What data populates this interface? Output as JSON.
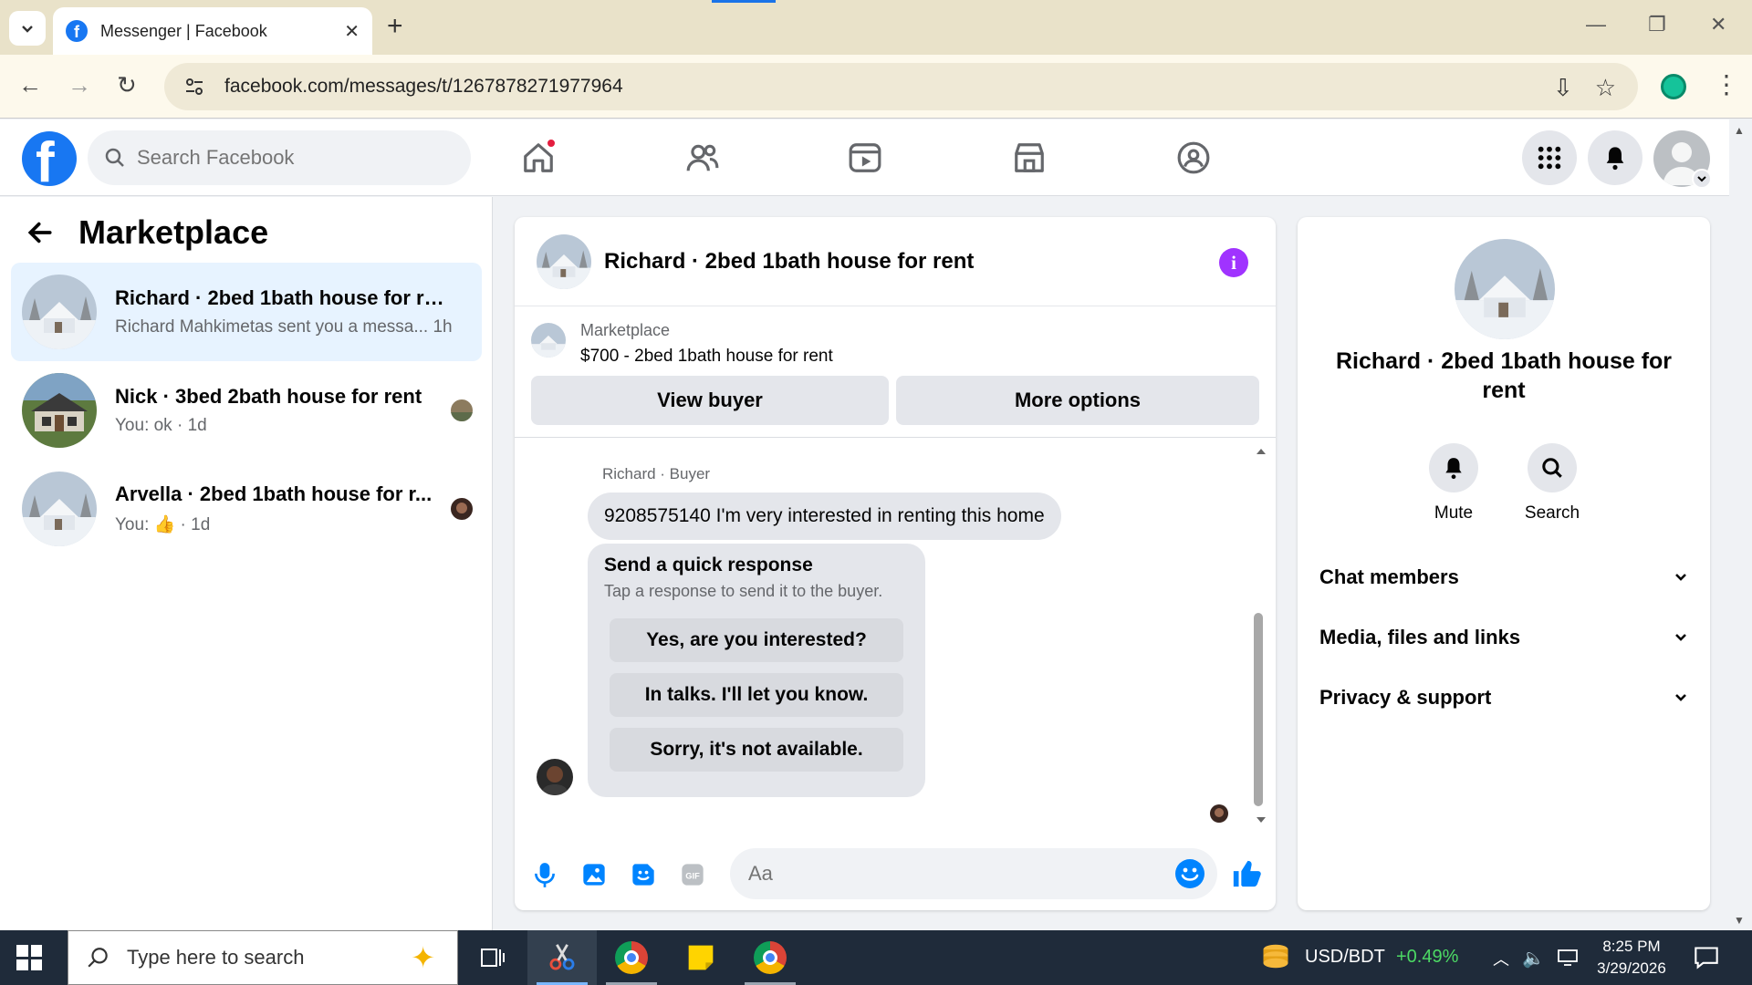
{
  "browser": {
    "tab_title": "Messenger | Facebook",
    "url": "facebook.com/messages/t/1267878271977964"
  },
  "fbnav": {
    "search_placeholder": "Search Facebook"
  },
  "left": {
    "title": "Marketplace",
    "conversations": [
      {
        "name": "Richard · 2bed 1bath house for rent",
        "subtitle": "Richard Mahkimetas sent you a messa... 1h"
      },
      {
        "name": "Nick · 3bed 2bath house for rent",
        "subtitle": "You: ok · 1d"
      },
      {
        "name": "Arvella · 2bed 1bath house for r...",
        "subtitle": "You: 👍 · 1d"
      }
    ]
  },
  "chat": {
    "title": "Richard · 2bed 1bath house for rent",
    "marketplace_label": "Marketplace",
    "listing": "$700 - 2bed 1bath house for rent",
    "view_buyer_label": "View buyer",
    "more_options_label": "More options",
    "sender_label": "Richard · Buyer",
    "message_text": "9208575140 I'm very interested in renting this home",
    "quick_title": "Send a quick response",
    "quick_subtitle": "Tap a response to send it to the buyer.",
    "quick_responses": [
      "Yes, are you interested?",
      "In talks. I'll let you know.",
      "Sorry, it's not available."
    ],
    "composer_placeholder": "Aa"
  },
  "right": {
    "title": "Richard · 2bed 1bath house for rent",
    "mute_label": "Mute",
    "search_label": "Search",
    "sections": [
      "Chat members",
      "Media, files and links",
      "Privacy & support"
    ]
  },
  "taskbar": {
    "search_placeholder": "Type here to search",
    "currency_label": "USD/BDT",
    "currency_change": "+0.49%",
    "time": "8:25 PM",
    "date": "3/29/2026"
  },
  "colors": {
    "fb_blue": "#1877f2",
    "messenger_blue": "#0084ff",
    "info_purple": "#a033ff",
    "active_conv": "#e7f3ff",
    "positive_green": "#4cd964"
  }
}
